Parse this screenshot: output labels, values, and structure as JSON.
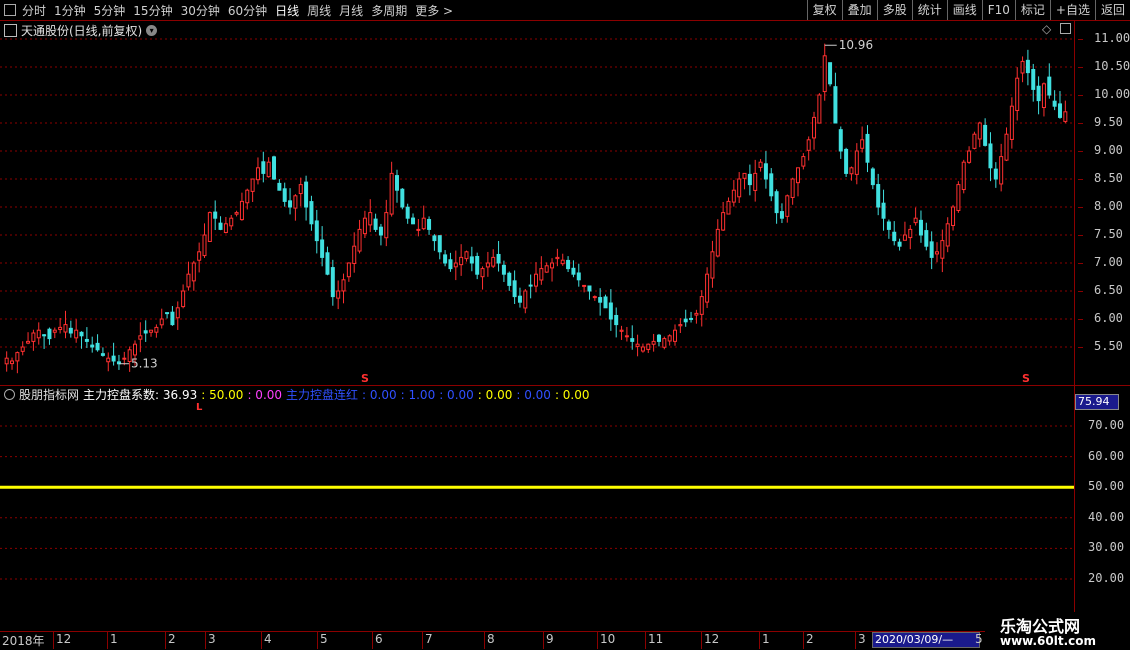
{
  "toolbar": {
    "left_items": [
      "分时",
      "1分钟",
      "5分钟",
      "15分钟",
      "30分钟",
      "60分钟",
      "日线",
      "周线",
      "月线",
      "多周期",
      "更多 >"
    ],
    "active_index": 6,
    "right_items": [
      "复权",
      "叠加",
      "多股",
      "统计",
      "画线",
      "F10",
      "标记",
      "+自选",
      "返回"
    ]
  },
  "stock": {
    "title": "天通股份(日线,前复权)",
    "high_label": "10.96",
    "low_label": "5.13",
    "signal_s": "S"
  },
  "price_axis": {
    "labels": [
      "11.00",
      "10.50",
      "10.00",
      "9.50",
      "9.00",
      "8.50",
      "8.00",
      "7.50",
      "7.00",
      "6.50",
      "6.00",
      "5.50"
    ],
    "values": [
      11.0,
      10.5,
      10.0,
      9.5,
      9.0,
      8.5,
      8.0,
      7.5,
      7.0,
      6.5,
      6.0,
      5.5
    ]
  },
  "indicator": {
    "name": "股朋指标网",
    "series": [
      {
        "label": "主力控盘系数: 36.93",
        "color": "#ffffff"
      },
      {
        "label": ": 50.00",
        "color": "#ffff00"
      },
      {
        "label": ": 0.00",
        "color": "#ff40ff"
      },
      {
        "label": "主力控盘连红",
        "color": "#3050ff"
      },
      {
        "label": ": 0.00",
        "color": "#3050ff"
      },
      {
        "label": ": 1.00",
        "color": "#3050ff"
      },
      {
        "label": ": 0.00",
        "color": "#3050ff"
      },
      {
        "label": ": 0.00",
        "color": "#ffff00"
      },
      {
        "label": ": 0.00",
        "color": "#3050ff"
      },
      {
        "label": ": 0.00",
        "color": "#ffff00"
      }
    ],
    "marker_l": "L",
    "current_value": "75.94",
    "axis_labels": [
      "70.00",
      "60.00",
      "50.00",
      "40.00",
      "30.00",
      "20.00"
    ],
    "axis_values": [
      70,
      60,
      50,
      40,
      30,
      20
    ],
    "line_value": 50
  },
  "time_axis": {
    "year": "2018年",
    "months": [
      "12",
      "1",
      "2",
      "3",
      "4",
      "5",
      "6",
      "7",
      "8",
      "9",
      "10",
      "11",
      "12",
      "1",
      "2",
      "3"
    ],
    "date_box": "2020/03/09/—",
    "trailing": "5"
  },
  "watermark": {
    "line1": "乐淘公式网",
    "line2": "www.60lt.com"
  },
  "colors": {
    "up": "#ff3030",
    "down": "#40e0e0",
    "grid": "#8b0000",
    "ma": "#ffff00"
  },
  "chart_data": {
    "type": "candlestick",
    "series_close": [
      5.3,
      5.25,
      5.4,
      5.5,
      5.6,
      5.75,
      5.8,
      5.7,
      5.65,
      5.8,
      5.85,
      5.9,
      5.75,
      5.8,
      5.7,
      5.6,
      5.5,
      5.45,
      5.35,
      5.3,
      5.25,
      5.2,
      5.3,
      5.45,
      5.55,
      5.7,
      5.75,
      5.8,
      5.85,
      6.0,
      6.1,
      5.9,
      6.2,
      6.5,
      6.8,
      7.0,
      7.2,
      7.5,
      7.9,
      7.8,
      7.6,
      7.7,
      7.8,
      7.9,
      8.1,
      8.3,
      8.5,
      8.7,
      8.6,
      8.8,
      8.5,
      8.3,
      8.1,
      8.0,
      8.2,
      8.4,
      8.0,
      7.7,
      7.4,
      7.1,
      6.8,
      6.4,
      6.5,
      6.7,
      7.0,
      7.3,
      7.6,
      7.8,
      7.9,
      7.6,
      7.5,
      7.9,
      8.6,
      8.3,
      8.0,
      7.8,
      7.7,
      7.6,
      7.8,
      7.6,
      7.4,
      7.2,
      7.0,
      6.9,
      7.0,
      7.1,
      7.2,
      7.0,
      6.8,
      6.9,
      7.0,
      7.1,
      7.0,
      6.8,
      6.6,
      6.4,
      6.3,
      6.5,
      6.6,
      6.8,
      6.9,
      6.95,
      7.0,
      7.1,
      7.05,
      6.9,
      6.8,
      6.7,
      6.6,
      6.5,
      6.4,
      6.3,
      6.2,
      6.0,
      5.9,
      5.8,
      5.7,
      5.6,
      5.55,
      5.5,
      5.55,
      5.6,
      5.6,
      5.65,
      5.7,
      5.8,
      5.9,
      5.95,
      6.0,
      6.1,
      6.4,
      6.8,
      7.2,
      7.6,
      7.9,
      8.1,
      8.3,
      8.5,
      8.6,
      8.4,
      8.6,
      8.8,
      8.5,
      8.2,
      7.9,
      7.8,
      8.2,
      8.5,
      8.7,
      8.9,
      9.2,
      9.6,
      10.0,
      10.7,
      10.2,
      9.5,
      9.0,
      8.6,
      8.7,
      9.0,
      9.2,
      8.8,
      8.4,
      8.0,
      7.8,
      7.6,
      7.4,
      7.3,
      7.5,
      7.6,
      7.8,
      7.5,
      7.3,
      7.1,
      7.2,
      7.4,
      7.7,
      8.0,
      8.4,
      8.8,
      9.0,
      9.3,
      9.5,
      9.1,
      8.7,
      8.5,
      8.9,
      9.3,
      9.8,
      10.3,
      10.6,
      10.4,
      10.1,
      9.9,
      10.2,
      10.0,
      9.8,
      9.6,
      9.7
    ],
    "ylim": [
      5.0,
      11.2
    ],
    "indicator_line": 50,
    "indicator_ylim": [
      15,
      80
    ]
  }
}
